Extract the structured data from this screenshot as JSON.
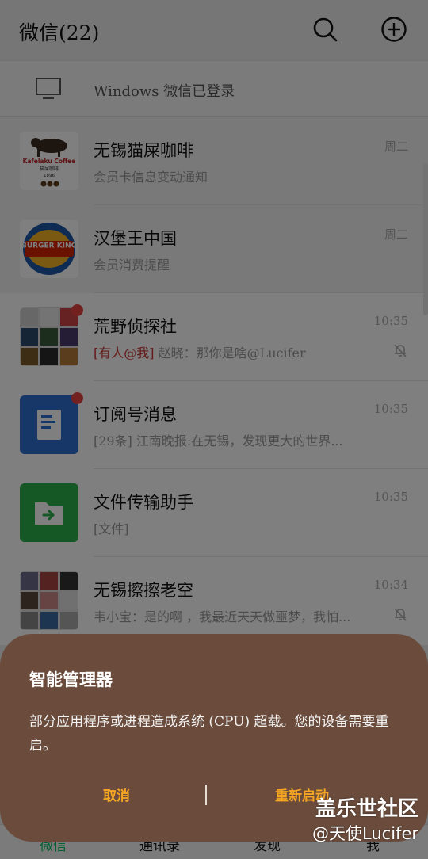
{
  "header": {
    "title": "微信(22)"
  },
  "pc_banner": {
    "text": "Windows 微信已登录"
  },
  "chats": [
    {
      "name": "无锡猫屎咖啡",
      "preview": "会员卡信息变动通知",
      "time": "周二",
      "pinned": true,
      "avatar_text": "Kafelaku Coffee",
      "avatar_sub": "猫屎咖啡",
      "avatar_year": "1896"
    },
    {
      "name": "汉堡王中国",
      "preview": "会员消费提醒",
      "time": "周二",
      "pinned": true,
      "avatar_text": "BURGER KING"
    },
    {
      "name": "荒野侦探社",
      "mention": "[有人@我]",
      "preview": " 赵晓：那你是啥@Lucifer",
      "time": "10:35",
      "muted": true,
      "unread_dot": true
    },
    {
      "name": "订阅号消息",
      "preview": "[29条] 江南晚报:在无锡，发现更大的世界...",
      "time": "10:35",
      "unread_dot": true
    },
    {
      "name": "文件传输助手",
      "preview": "[文件]",
      "time": "10:35"
    },
    {
      "name": "无锡擦擦老空",
      "preview": "韦小宝：是的啊 ，我最近天天做噩梦，我怕...",
      "time": "10:34",
      "muted": true
    }
  ],
  "tabs": [
    "微信",
    "通讯录",
    "发现",
    "我"
  ],
  "dialog": {
    "title": "智能管理器",
    "message": "部分应用程序或进程造成系统 (CPU) 超载。您的设备需要重启。",
    "cancel": "取消",
    "restart": "重新启动"
  },
  "watermark": {
    "line1": "盖乐世社区",
    "line2": "@天使Lucifer"
  },
  "colors": {
    "accent": "#07c160",
    "dialog_bg": "#6b4c3c",
    "dialog_button": "#f6a623",
    "unread": "#e64340"
  }
}
